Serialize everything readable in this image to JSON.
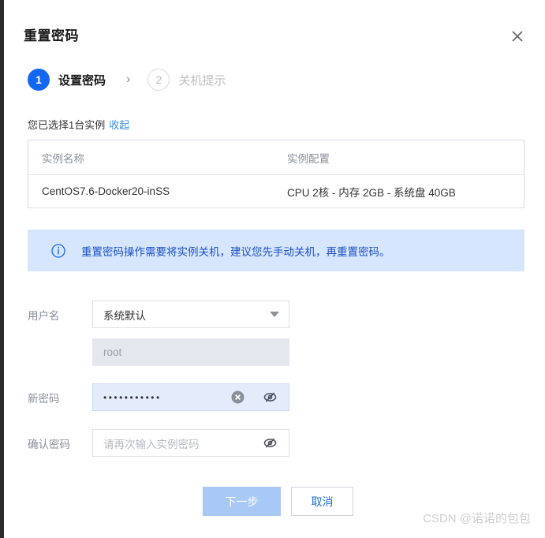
{
  "dialog": {
    "title": "重置密码",
    "close_icon": "close-icon"
  },
  "steps": [
    {
      "number": "1",
      "label": "设置密码",
      "state": "active"
    },
    {
      "number": "2",
      "label": "关机提示",
      "state": "inactive"
    }
  ],
  "step_separator": "›",
  "selection": {
    "summary": "您已选择1台实例",
    "toggle_link": "收起"
  },
  "instance_table": {
    "columns": [
      "实例名称",
      "实例配置"
    ],
    "rows": [
      {
        "name": "CentOS7.6-Docker20-inSS",
        "config": "CPU 2核 - 内存 2GB - 系统盘 40GB"
      }
    ]
  },
  "alert": {
    "icon": "info-circle-icon",
    "text": "重置密码操作需要将实例关机，建议您先手动关机，再重置密码。",
    "background_color": "#d7e6ff",
    "text_color": "#1a4fc4"
  },
  "form": {
    "username": {
      "label": "用户名",
      "select_value": "系统默认",
      "options": [
        "系统默认"
      ],
      "dropdown_icon": "chevron-down-icon"
    },
    "username_readonly": {
      "value": "root",
      "disabled": true
    },
    "new_password": {
      "label": "新密码",
      "value": "•••••••••••",
      "clear_icon": "clear-circle-icon",
      "visibility_icon": "eye-off-icon"
    },
    "confirm_password": {
      "label": "确认密码",
      "value": "",
      "placeholder": "请再次输入实例密码",
      "visibility_icon": "eye-off-icon"
    }
  },
  "footer": {
    "next_label": "下一步",
    "next_disabled": true,
    "cancel_label": "取消"
  },
  "watermark": "CSDN @诺诺的包包",
  "colors": {
    "primary": "#1467f0",
    "link": "#3a8ee6",
    "disabled_button": "#a8c8f5",
    "cancel_text": "#2170d8"
  }
}
